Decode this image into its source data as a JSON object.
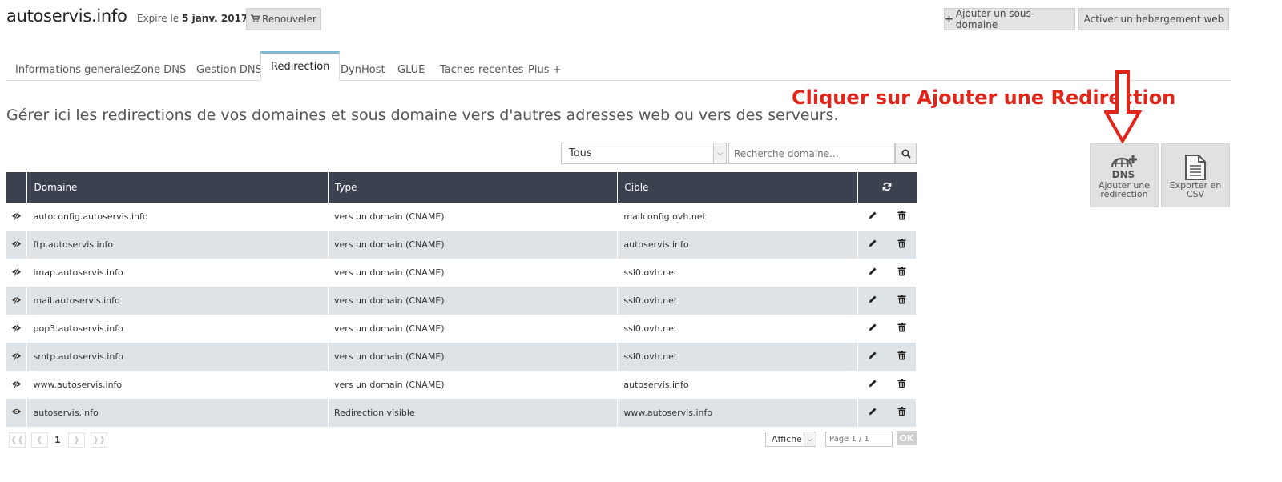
{
  "header": {
    "domain": "autoservis.info",
    "expire_prefix": "Expire le",
    "expire_date": "5 janv. 2017",
    "renew_label": "Renouveler",
    "add_subdomain_label": "Ajouter un sous-domaine",
    "activate_hosting_label": "Activer un hebergement web"
  },
  "tabs": [
    {
      "label": "Informations generales"
    },
    {
      "label": "Zone DNS"
    },
    {
      "label": "Gestion DNS"
    },
    {
      "label": "Redirection",
      "active": true
    },
    {
      "label": "DynHost"
    },
    {
      "label": "GLUE"
    },
    {
      "label": "Taches recentes"
    },
    {
      "label": "Plus +"
    }
  ],
  "intro": "Gérer ici les redirections de vos domaines et sous domaine vers d'autres adresses web ou vers des serveurs.",
  "annotation": "Cliquer sur Ajouter une Redirection",
  "filter": {
    "selected": "Tous",
    "search_placeholder": "Recherche domaine..."
  },
  "table": {
    "columns": [
      "Domaine",
      "Type",
      "Cible"
    ],
    "rows": [
      {
        "domain": "autoconfig.autoservis.info",
        "type": "vers un domain (CNAME)",
        "target": "mailconfig.ovh.net",
        "icon": "eye-slash-icon"
      },
      {
        "domain": "ftp.autoservis.info",
        "type": "vers un domain (CNAME)",
        "target": "autoservis.info",
        "icon": "eye-slash-icon"
      },
      {
        "domain": "imap.autoservis.info",
        "type": "vers un domain (CNAME)",
        "target": "ssl0.ovh.net",
        "icon": "eye-slash-icon"
      },
      {
        "domain": "mail.autoservis.info",
        "type": "vers un domain (CNAME)",
        "target": "ssl0.ovh.net",
        "icon": "eye-slash-icon"
      },
      {
        "domain": "pop3.autoservis.info",
        "type": "vers un domain (CNAME)",
        "target": "ssl0.ovh.net",
        "icon": "eye-slash-icon"
      },
      {
        "domain": "smtp.autoservis.info",
        "type": "vers un domain (CNAME)",
        "target": "ssl0.ovh.net",
        "icon": "eye-slash-icon"
      },
      {
        "domain": "www.autoservis.info",
        "type": "vers un domain (CNAME)",
        "target": "autoservis.info",
        "icon": "eye-slash-icon"
      },
      {
        "domain": "autoservis.info",
        "type": "Redirection visible",
        "target": "www.autoservis.info",
        "icon": "eye-icon"
      }
    ]
  },
  "pagination": {
    "current_page": "1",
    "per_page_label": "Affiche",
    "page_placeholder": "Page 1 / 1",
    "ok_label": "OK"
  },
  "side": {
    "add_redirect_icon_text": "DNS",
    "add_redirect_line1": "Ajouter une",
    "add_redirect_line2": "redirection",
    "export_line1": "Exporter en",
    "export_line2": "CSV"
  },
  "colors": {
    "table_header": "#3c4150",
    "row_alt": "#dde3e6",
    "annotation": "#e0251b",
    "tab_accent": "#7fb9d6"
  }
}
